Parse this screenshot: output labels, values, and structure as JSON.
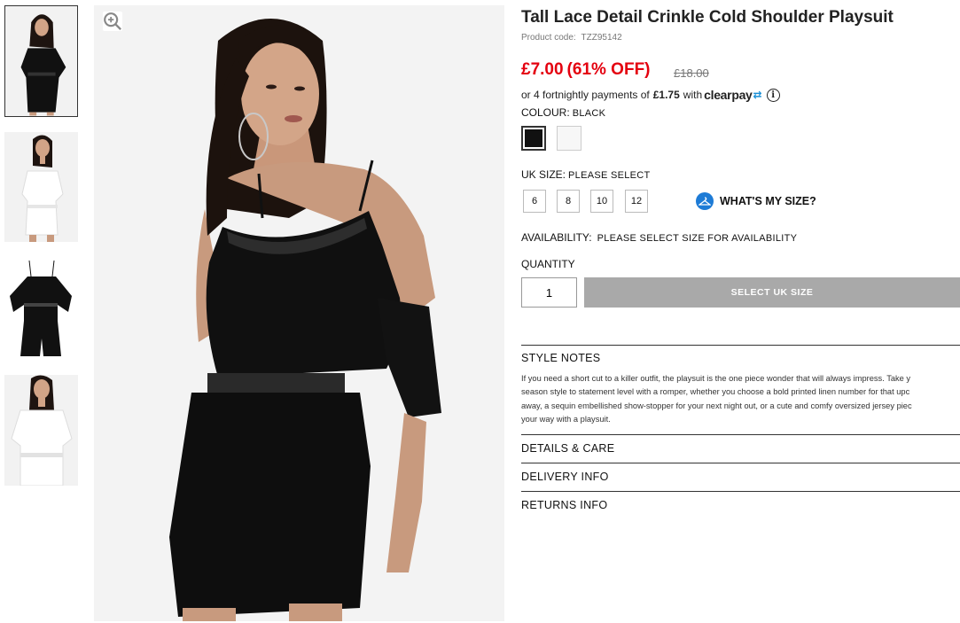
{
  "gallery": {
    "thumbnails": [
      {
        "name": "thumbnail-1",
        "outfit": "black",
        "active": true
      },
      {
        "name": "thumbnail-2",
        "outfit": "white",
        "active": false
      },
      {
        "name": "thumbnail-3",
        "outfit": "black-flat",
        "active": false
      },
      {
        "name": "thumbnail-4",
        "outfit": "white",
        "active": false
      }
    ],
    "zoom_icon": "zoom-in-icon"
  },
  "product": {
    "title": "Tall Lace Detail Crinkle Cold Shoulder Playsuit",
    "code_label": "Product code:",
    "code": "TZZ95142",
    "price": "£7.00",
    "discount": "(61% OFF)",
    "old_price": "£18.00",
    "price_color": "#e4000f"
  },
  "clearpay": {
    "prefix": "or 4 fortnightly payments of",
    "amount": "£1.75",
    "suffix": "with",
    "logo_text": "clearpay",
    "logo_arrows": "⇄",
    "info_icon": "info-icon",
    "accent_color": "#1a8fd6"
  },
  "colour": {
    "label": "COLOUR:",
    "value": "BLACK",
    "swatches": [
      {
        "name": "black",
        "color": "#111111",
        "selected": true
      },
      {
        "name": "white",
        "color": "#f7f7f7",
        "selected": false
      }
    ]
  },
  "size": {
    "label": "UK SIZE:",
    "value": "PLEASE SELECT",
    "options": [
      "6",
      "8",
      "10",
      "12"
    ],
    "guide_label": "WHAT'S MY SIZE?",
    "guide_icon": "hanger-icon"
  },
  "availability": {
    "label": "AVAILABILITY:",
    "value": "PLEASE SELECT SIZE FOR AVAILABILITY"
  },
  "quantity": {
    "label": "QUANTITY",
    "value": "1",
    "button_label": "SELECT UK SIZE"
  },
  "sections": {
    "style_notes": {
      "heading": "STYLE NOTES",
      "lines": [
        "If you need a short cut to a killer outfit, the playsuit is the one piece wonder that will always impress. Take y",
        "season style to statement level with a romper, whether you choose a bold printed linen number for that upc",
        "away, a sequin embellished show-stopper for your next night out, or a cute and comfy oversized jersey piec",
        "your way with a playsuit."
      ]
    },
    "details": {
      "heading": "DETAILS & CARE"
    },
    "delivery": {
      "heading": "DELIVERY INFO"
    },
    "returns": {
      "heading": "RETURNS INFO"
    }
  }
}
